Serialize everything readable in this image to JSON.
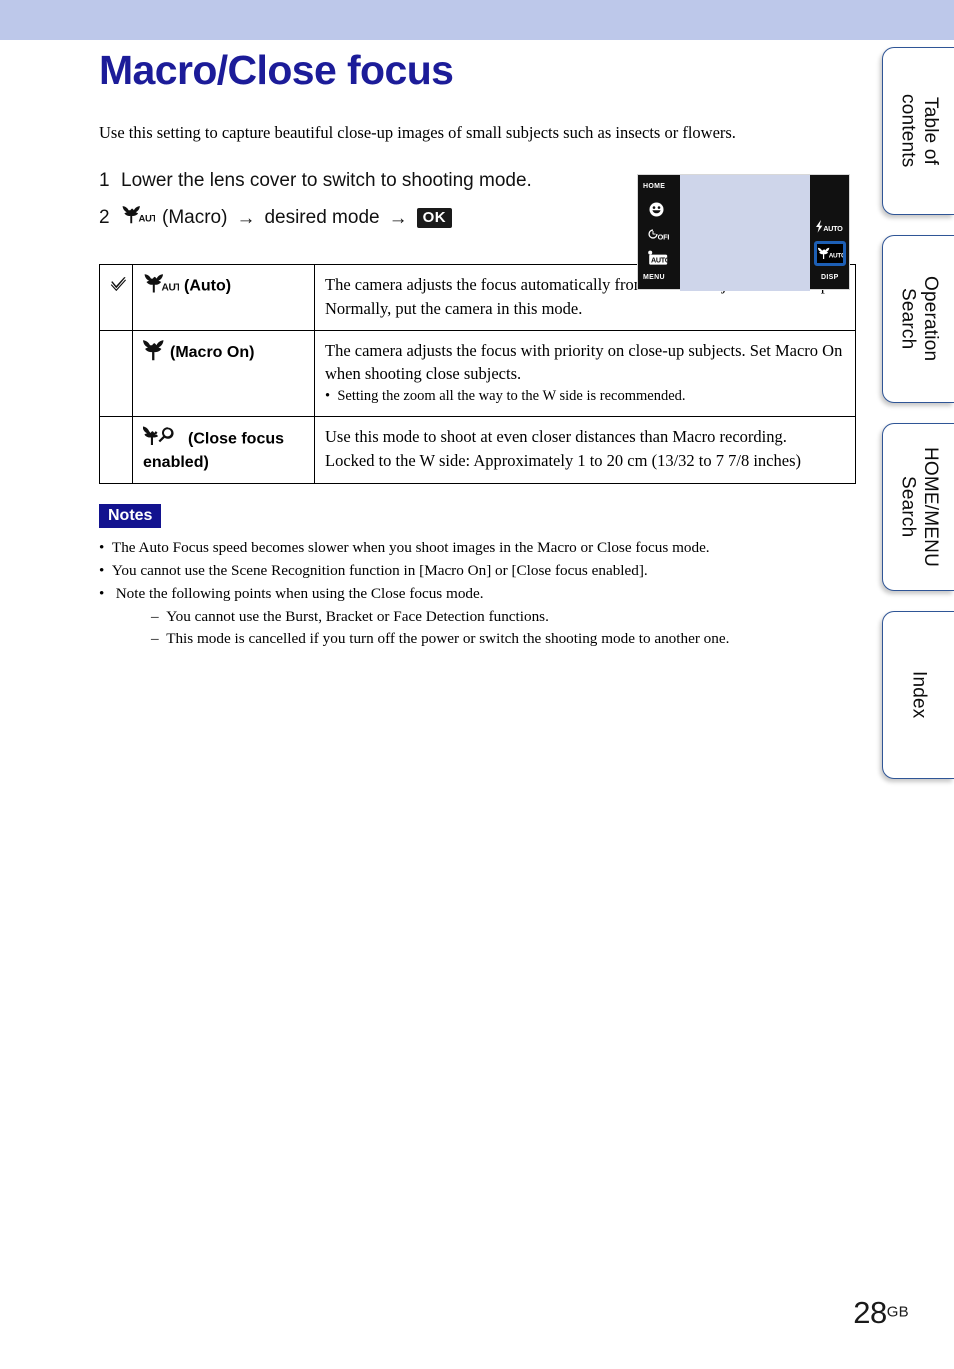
{
  "band": {
    "color": "#bdc8ea"
  },
  "title": "Macro/Close focus",
  "title_color": "#1c1c99",
  "intro": "Use this setting to capture beautiful close-up images of small subjects such as insects or flowers.",
  "steps": [
    {
      "num": "1",
      "text": "Lower the lens cover to switch to shooting mode."
    },
    {
      "num": "2",
      "icon": "macro-auto-icon",
      "part1": "(Macro)",
      "arrow1": "→",
      "part2": "desired mode",
      "arrow2": "→",
      "ok_label": "OK"
    }
  ],
  "camera_screen": {
    "home_label": "HOME",
    "menu_label": "MENU",
    "disp_label": "DISP",
    "smile_icon": "smile-detection-icon",
    "timer_label": "OFF",
    "timer_icon": "self-timer-icon",
    "burst_label": "AUTO",
    "burst_icon": "burst-mode-icon",
    "flash_label": "AUTO",
    "flash_icon": "flash-auto-icon",
    "macro_label": "AUTO",
    "macro_icon": "macro-auto-icon",
    "highlight_color": "#1d5fb5",
    "viewfinder_color": "#ced5ea"
  },
  "table": {
    "rows": [
      {
        "checked": true,
        "check_glyph": "✓",
        "icon": "macro-auto-icon",
        "mode": "(Auto)",
        "desc_lines": [
          "The camera adjusts the focus automatically from distant subjects to close-up. Normally, put the camera in this mode."
        ],
        "bullets": []
      },
      {
        "checked": false,
        "check_glyph": "",
        "icon": "macro-on-icon",
        "mode": "(Macro On)",
        "desc_lines": [
          "The camera adjusts the focus with priority on close-up subjects. Set Macro On when shooting close subjects."
        ],
        "bullets": [
          "Setting the zoom all the way to the W side is recommended."
        ]
      },
      {
        "checked": false,
        "check_glyph": "",
        "icon": "close-focus-icon",
        "mode": "(Close focus enabled)",
        "desc_lines": [
          "Use this mode to shoot at even closer distances than Macro recording.",
          "Locked to the W side: Approximately 1 to 20 cm (13/32 to 7 7/8 inches)"
        ],
        "bullets": []
      }
    ]
  },
  "notes": {
    "badge": "Notes",
    "badge_bg": "#13138f",
    "items": [
      {
        "text": "The Auto Focus speed becomes slower when you shoot images in the Macro or Close focus mode.",
        "subs": []
      },
      {
        "text": "You cannot use the Scene Recognition function in [Macro On] or [Close focus enabled].",
        "subs": []
      },
      {
        "text": "Note the following points when using the Close focus mode.",
        "subs": [
          "You cannot use the Burst, Bracket or Face Detection functions.",
          "This mode is cancelled if you turn off the power or switch the shooting mode to another one."
        ]
      }
    ]
  },
  "side_tabs": [
    {
      "label": "Table of\ncontents"
    },
    {
      "label": "Operation\nSearch"
    },
    {
      "label": "HOME/MENU\nSearch"
    },
    {
      "label": "Index"
    }
  ],
  "footer": {
    "page": "28",
    "region": "GB"
  }
}
